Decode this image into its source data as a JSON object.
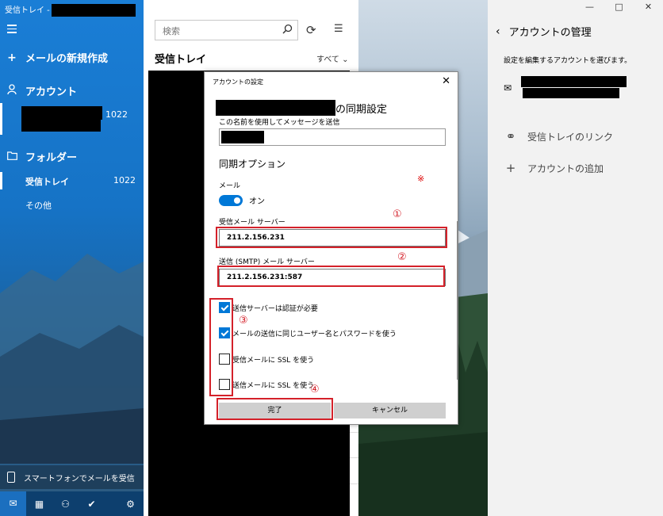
{
  "window": {
    "title": "受信トレイ -",
    "controls": [
      "—",
      "□",
      "✕"
    ]
  },
  "nav": {
    "new_mail": "メールの新規作成",
    "accounts_label": "アカウント",
    "account_count": "1022",
    "folders_label": "フォルダー",
    "inbox_label": "受信トレイ",
    "inbox_count": "1022",
    "other_label": "その他",
    "phone_label": "スマートフォンでメールを受信"
  },
  "list": {
    "search_placeholder": "検索",
    "title": "受信トレイ",
    "filter": "すべて ⌄"
  },
  "right_pane": {
    "title": "アカウントの管理",
    "subtitle": "設定を編集するアカウントを選びます。",
    "link_inboxes": "受信トレイのリンク",
    "add_account": "アカウントの追加"
  },
  "dialog": {
    "title": "アカウントの設定",
    "sync_settings_suffix": "の同期設定",
    "send_name_label": "この名前を使用してメッセージを送信",
    "sync_options_title": "同期オプション",
    "mail_label": "メール",
    "toggle_state": "オン",
    "note_mark": "※",
    "incoming_label": "受信メール サーバー",
    "incoming_value": "211.2.156.231",
    "outgoing_label": "送信 (SMTP) メール サーバー",
    "outgoing_value": "211.2.156.231:587",
    "checks": [
      {
        "label": "送信サーバーは認証が必要",
        "checked": true
      },
      {
        "label": "メールの送信に同じユーザー名とパスワードを使う",
        "checked": true
      },
      {
        "label": "受信メールに SSL を使う",
        "checked": false
      },
      {
        "label": "送信メールに SSL を使う",
        "checked": false
      }
    ],
    "done_button": "完了",
    "cancel_button": "キャンセル",
    "annotations": [
      "①",
      "②",
      "③",
      "④"
    ],
    "annotation_color": "#d4212a"
  },
  "colors": {
    "accent": "#0078d7",
    "nav": "#1a7ed6"
  }
}
